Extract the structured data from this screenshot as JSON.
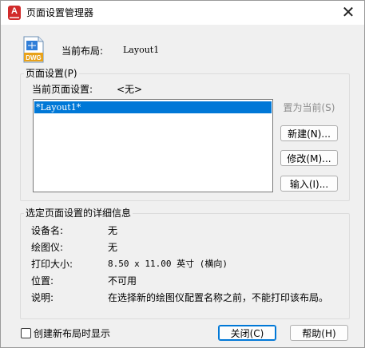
{
  "window": {
    "title": "页面设置管理器",
    "app_icon_letter": "A",
    "close_glyph": "✕"
  },
  "current_layout": {
    "label": "当前布局:",
    "value": "Layout1",
    "icon": "dwg-file-icon",
    "icon_text": "DWG"
  },
  "page_setups": {
    "group_title": "页面设置(P)",
    "current_label": "当前页面设置:",
    "current_value": "<无>",
    "list_items": [
      "*Layout1*"
    ],
    "buttons": {
      "set_current": "置为当前(S)",
      "new": "新建(N)...",
      "modify": "修改(M)...",
      "import": "输入(I)..."
    }
  },
  "details": {
    "group_title": "选定页面设置的详细信息",
    "rows": [
      {
        "label": "设备名:",
        "value": "无"
      },
      {
        "label": "绘图仪:",
        "value": "无"
      },
      {
        "label": "打印大小:",
        "value": "8.50 x 11.00 英寸 (横向)"
      },
      {
        "label": "位置:",
        "value": "不可用"
      },
      {
        "label": "说明:",
        "value": "在选择新的绘图仪配置名称之前，不能打印该布局。"
      }
    ]
  },
  "footer": {
    "checkbox_label": "创建新布局时显示",
    "checkbox_checked": false,
    "close_button": "关闭(C)",
    "help_button": "帮助(H)"
  },
  "colors": {
    "selection": "#0078d7",
    "app_icon": "#d12b2b",
    "background": "#f0f0f0"
  }
}
